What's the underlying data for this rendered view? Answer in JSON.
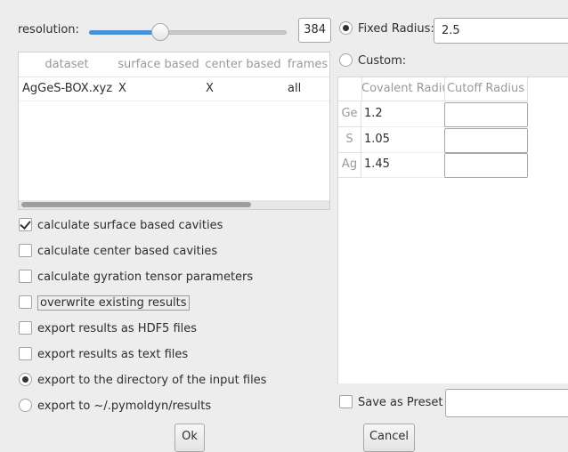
{
  "resolution": {
    "label": "resolution:",
    "value": "384",
    "slider_fraction": 0.36
  },
  "dataset_table": {
    "columns": [
      "dataset",
      "surface based",
      "center based",
      "frames"
    ],
    "rows": [
      {
        "dataset": "AgGeS-BOX.xyz",
        "surface": "X",
        "center": "X",
        "frames": "all"
      }
    ]
  },
  "options": {
    "surface": {
      "label": "calculate surface based cavities",
      "checked": true
    },
    "center": {
      "label": "calculate center based cavities",
      "checked": false
    },
    "gyration": {
      "label": "calculate gyration tensor parameters",
      "checked": false
    },
    "overwrite": {
      "label": "overwrite existing results",
      "checked": false
    },
    "hdf5": {
      "label": "export results as HDF5 files",
      "checked": false
    },
    "text": {
      "label": "export results as text files",
      "checked": false
    },
    "export_input": {
      "label": "export to the directory of the input files",
      "selected": true
    },
    "export_home": {
      "label": "export to ~/.pymoldyn/results",
      "selected": false
    }
  },
  "buttons": {
    "ok": "Ok",
    "cancel": "Cancel"
  },
  "radius": {
    "fixed_label": "Fixed Radius:",
    "fixed_value": "2.5",
    "custom_label": "Custom:",
    "columns": [
      "Covalent Radius",
      "Cutoff Radius"
    ],
    "rows": [
      {
        "element": "Ge",
        "covalent": "1.2",
        "cutoff": ""
      },
      {
        "element": "S",
        "covalent": "1.05",
        "cutoff": ""
      },
      {
        "element": "Ag",
        "covalent": "1.45",
        "cutoff": ""
      }
    ]
  },
  "preset": {
    "label": "Save as Preset",
    "value": ""
  },
  "colors": {
    "accent": "#4a90d9",
    "panel": "#ededed"
  }
}
